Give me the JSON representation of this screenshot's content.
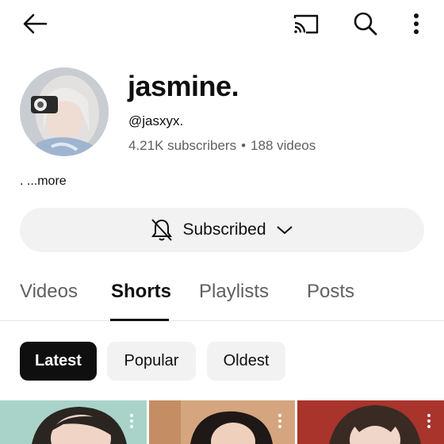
{
  "header": {
    "back_icon": "arrow-left-icon",
    "cast_icon": "cast-icon",
    "search_icon": "search-icon",
    "more_icon": "more-vertical-icon"
  },
  "channel": {
    "name": "jasmine.",
    "handle": "@jasxyx.",
    "subscribers": "4.21K subscribers",
    "separator": "•",
    "videos": "188 videos",
    "more_label": ". ...more"
  },
  "subscribe": {
    "label": "Subscribed",
    "bell_icon": "bell-off-icon",
    "chevron_icon": "chevron-down-icon"
  },
  "tabs": [
    {
      "label": "Videos",
      "active": false
    },
    {
      "label": "Shorts",
      "active": true
    },
    {
      "label": "Playlists",
      "active": false
    },
    {
      "label": "Posts",
      "active": false
    }
  ],
  "filters": [
    {
      "label": "Latest",
      "active": true
    },
    {
      "label": "Popular",
      "active": false
    },
    {
      "label": "Oldest",
      "active": false
    }
  ],
  "colors": {
    "chip_bg": "#f2f2f2",
    "active_chip_bg": "#0f0f0f",
    "secondary_text": "#606060"
  }
}
